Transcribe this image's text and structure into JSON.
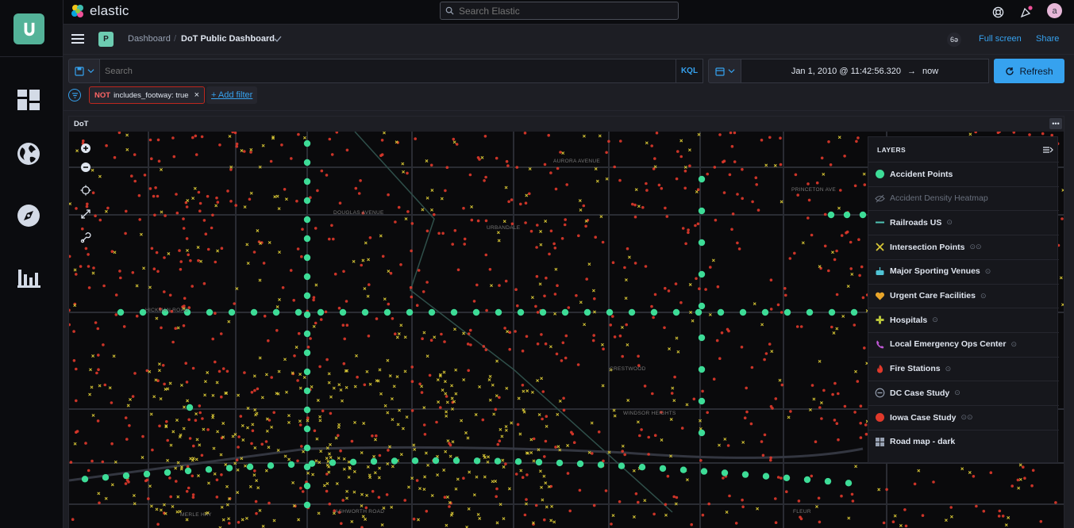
{
  "app": {
    "brand": "elastic",
    "search_placeholder": "Search Elastic",
    "avatar_initial": "a"
  },
  "breadcrumbs": {
    "root": "Dashboard",
    "current": "DoT Public Dashboard",
    "space": "P"
  },
  "header_links": {
    "fullscreen": "Full screen",
    "share": "Share",
    "glasses": "6ə"
  },
  "query": {
    "placeholder": "Search",
    "language": "KQL",
    "start": "Jan 1, 2010 @ 11:42:56.320",
    "arrow": "→",
    "end": "now",
    "refresh": "Refresh"
  },
  "filters": [
    {
      "negated": "NOT",
      "label": "includes_footway: true"
    }
  ],
  "add_filter": "+ Add filter",
  "panel": {
    "title": "DoT",
    "menu": "•••"
  },
  "streets": [
    "AURORA AVENUE",
    "DOUGLAS AVENUE",
    "URBANDALE",
    "HICKMAN ROAD",
    "CRESTWOOD",
    "WINDSOR HEIGHTS",
    "ASHWORTH ROAD",
    "FLEUR",
    "PRINCETON AVE",
    "MERLE HAY"
  ],
  "layers": {
    "title": "LAYERS",
    "items": [
      {
        "label": "Accident Points",
        "dim": false,
        "info": "",
        "icon": "green-dot",
        "color": "#3ddc97"
      },
      {
        "label": "Accident Density Heatmap",
        "dim": true,
        "info": "",
        "icon": "hidden-eye",
        "color": "#69707d"
      },
      {
        "label": "Railroads US",
        "dim": false,
        "info": "⊙",
        "icon": "line",
        "color": "#4fc3b5"
      },
      {
        "label": "Intersection Points",
        "dim": false,
        "info": "⊙⊙",
        "icon": "x-mark",
        "color": "#d6c535"
      },
      {
        "label": "Major Sporting Venues",
        "dim": false,
        "info": "⊙",
        "icon": "stadium",
        "color": "#4fc3d5"
      },
      {
        "label": "Urgent Care Facilities",
        "dim": false,
        "info": "⊙",
        "icon": "heart",
        "color": "#e8a52a"
      },
      {
        "label": "Hospitals",
        "dim": false,
        "info": "⊙",
        "icon": "plus",
        "color": "#b8c43a"
      },
      {
        "label": "Local Emergency Ops Center",
        "dim": false,
        "info": "⊙",
        "icon": "phone",
        "color": "#c058d6"
      },
      {
        "label": "Fire Stations",
        "dim": false,
        "info": "⊙",
        "icon": "fire",
        "color": "#e0392b"
      },
      {
        "label": "DC Case Study",
        "dim": false,
        "info": "⊙",
        "icon": "minus-circle",
        "color": "#98a2b3"
      },
      {
        "label": "Iowa Case Study",
        "dim": false,
        "info": "⊙⊙",
        "icon": "red-dot",
        "color": "#e0392b"
      },
      {
        "label": "Road map - dark",
        "dim": false,
        "info": "",
        "icon": "grid",
        "color": "#98a2b3"
      }
    ]
  },
  "colors": {
    "accent": "#36a2ef",
    "accident": "#3ddc97",
    "intersection": "#d6c535",
    "iowa": "#e0392b"
  }
}
